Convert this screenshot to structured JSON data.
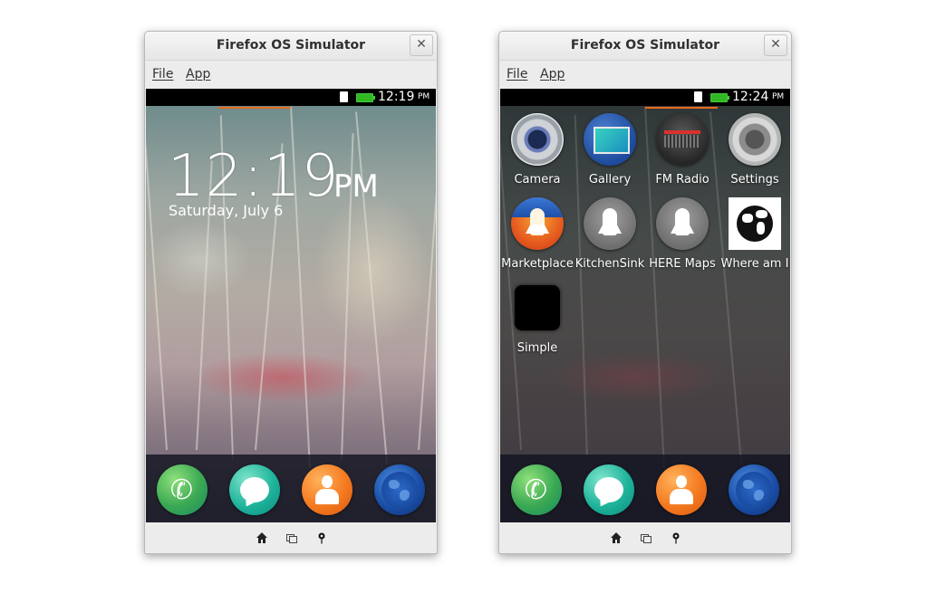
{
  "windows": [
    {
      "title": "Firefox OS Simulator",
      "close_label": "✕",
      "menu": {
        "file": "File",
        "app": "App"
      },
      "status": {
        "time": "12:19",
        "ampm": "PM"
      },
      "lockscreen": {
        "time": "12:19",
        "ampm": "PM",
        "date": "Saturday, July 6"
      },
      "dock": [
        "phone-icon",
        "messages-icon",
        "contacts-icon",
        "browser-icon"
      ],
      "nav": [
        "home-icon",
        "cards-icon",
        "geolocation-icon"
      ]
    },
    {
      "title": "Firefox OS Simulator",
      "close_label": "✕",
      "menu": {
        "file": "File",
        "app": "App"
      },
      "status": {
        "time": "12:24",
        "ampm": "PM"
      },
      "apps": [
        {
          "label": "Camera",
          "icon": "camera-icon"
        },
        {
          "label": "Gallery",
          "icon": "gallery-icon"
        },
        {
          "label": "FM Radio",
          "icon": "radio-icon"
        },
        {
          "label": "Settings",
          "icon": "settings-icon"
        },
        {
          "label": "Marketplace",
          "icon": "marketplace-icon"
        },
        {
          "label": "KitchenSink",
          "icon": "rocket-icon"
        },
        {
          "label": "HERE Maps",
          "icon": "rocket-icon"
        },
        {
          "label": "Where am I",
          "icon": "globe-icon"
        },
        {
          "label": "Simple",
          "icon": "blank-app-icon"
        }
      ],
      "dock": [
        "phone-icon",
        "messages-icon",
        "contacts-icon",
        "browser-icon"
      ],
      "nav": [
        "home-icon",
        "cards-icon",
        "geolocation-icon"
      ]
    }
  ],
  "colors": {
    "accent_orange": "#e66a1d",
    "battery_green": "#2fb824"
  }
}
